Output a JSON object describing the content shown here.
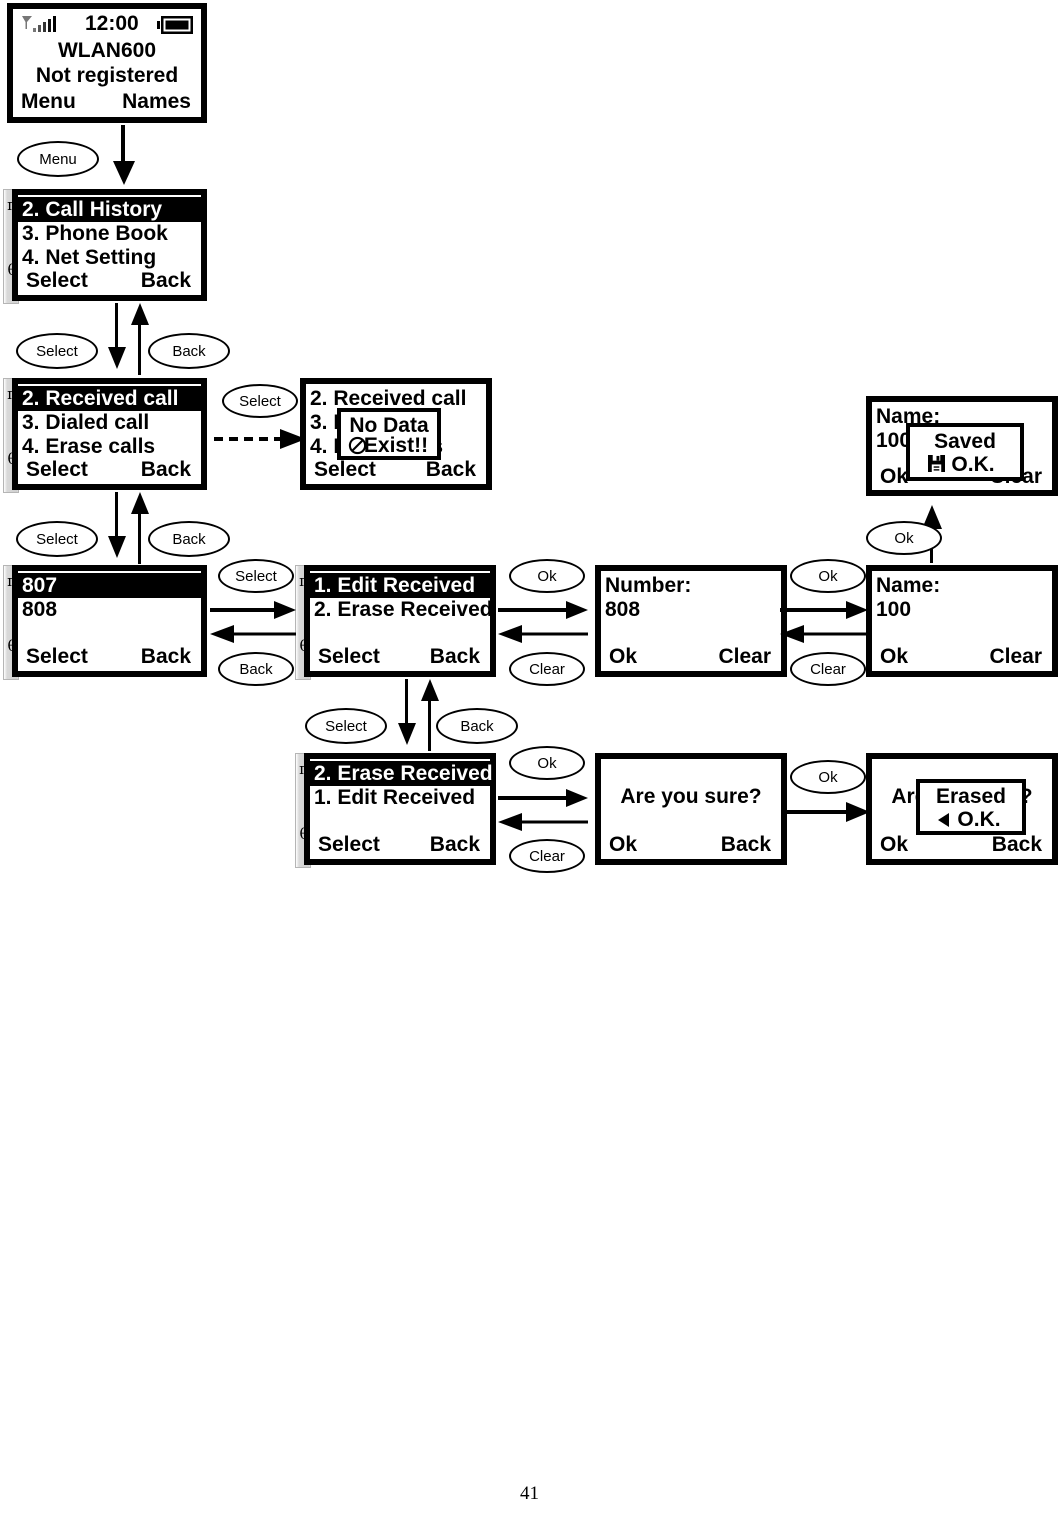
{
  "page": {
    "number": "41"
  },
  "symbols": {
    "scroll_up": "π",
    "scroll_down": "θ"
  },
  "screens": {
    "idle": {
      "name": "idle-screen",
      "time": "12:00",
      "operator": "WLAN600",
      "status": "Not registered",
      "softkey_left": "Menu",
      "softkey_right": "Names",
      "icons": {
        "signal": "signal-bars-icon",
        "battery": "battery-icon"
      }
    },
    "main_menu": {
      "name": "main-menu-screen",
      "items": [
        "2. Call History",
        "3. Phone Book",
        "4. Net Setting"
      ],
      "selected_index": 0,
      "softkey_left": "Select",
      "softkey_right": "Back"
    },
    "call_history": {
      "name": "call-history-screen",
      "items": [
        "2. Received call",
        "3. Dialed call",
        "4. Erase calls"
      ],
      "selected_index": 0,
      "softkey_left": "Select",
      "softkey_right": "Back"
    },
    "call_history_nodata": {
      "name": "call-history-no-data-screen",
      "items": [
        "2. Received call",
        "3. Dialed call",
        "4. Erase calls"
      ],
      "softkey_left": "Select",
      "softkey_right": "Back",
      "popup": {
        "line1": "No Data",
        "line2": "Exist!!",
        "icon": "prohibited-icon"
      }
    },
    "received_list": {
      "name": "received-call-list-screen",
      "items": [
        "807",
        "808"
      ],
      "selected_index": 0,
      "softkey_left": "Select",
      "softkey_right": "Back"
    },
    "edit_menu": {
      "name": "received-edit-menu-screen",
      "items": [
        "1. Edit Received",
        "2. Erase Received"
      ],
      "selected_index": 0,
      "softkey_left": "Select",
      "softkey_right": "Back"
    },
    "erase_menu": {
      "name": "received-erase-menu-screen",
      "items": [
        "2. Erase Received",
        "1. Edit Received"
      ],
      "selected_index": 0,
      "softkey_left": "Select",
      "softkey_right": "Back"
    },
    "number_edit": {
      "name": "number-edit-screen",
      "label": "Number:",
      "value": "808",
      "softkey_left": "Ok",
      "softkey_right": "Clear"
    },
    "name_edit": {
      "name": "name-edit-screen",
      "label": "Name:",
      "value": "100",
      "softkey_left": "Ok",
      "softkey_right": "Clear"
    },
    "name_saved": {
      "name": "name-saved-screen",
      "label": "Name:",
      "value": "100",
      "softkey_left": "Ok",
      "softkey_right": "Clear",
      "popup": {
        "line1": "Saved",
        "line2": "O.K.",
        "icon": "save-disk-icon"
      }
    },
    "confirm_erase": {
      "name": "confirm-erase-screen",
      "prompt": "Are you sure?",
      "softkey_left": "Ok",
      "softkey_right": "Back"
    },
    "erased_ok": {
      "name": "erased-confirmation-screen",
      "prompt": "Are you sure?",
      "softkey_left": "Ok",
      "softkey_right": "Back",
      "popup": {
        "line1": "Erased",
        "line2": "O.K.",
        "icon": "left-triangle-icon"
      }
    }
  },
  "buttons": {
    "menu": "Menu",
    "select": "Select",
    "back": "Back",
    "ok": "Ok",
    "clear": "Clear"
  }
}
